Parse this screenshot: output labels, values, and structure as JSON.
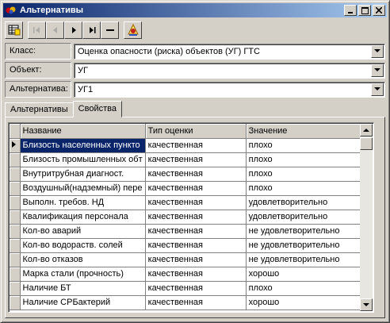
{
  "window": {
    "title": "Альтернативы",
    "icon": "app-icon"
  },
  "toolbar": {
    "buttons": [
      {
        "name": "table-view-icon",
        "enabled": true
      },
      {
        "name": "first-record-icon",
        "enabled": false
      },
      {
        "name": "prior-record-icon",
        "enabled": false
      },
      {
        "name": "next-record-icon",
        "enabled": true
      },
      {
        "name": "last-record-icon",
        "enabled": true
      },
      {
        "name": "delete-record-icon",
        "enabled": true
      },
      {
        "name": "refresh-icon",
        "enabled": true
      }
    ]
  },
  "fields": {
    "class_label": "Класс:",
    "class_value": "Оценка опасности (риска) объектов (УГ) ГТС",
    "object_label": "Объект:",
    "object_value": "УГ",
    "alternative_label": "Альтернатива:",
    "alternative_value": "УГ1"
  },
  "tabs": [
    {
      "label": "Альтернативы",
      "active": false
    },
    {
      "label": "Свойства",
      "active": true
    }
  ],
  "grid": {
    "columns": [
      "Название",
      "Тип оценки",
      "Значение"
    ],
    "rows": [
      {
        "name": "Близость населенных пункто",
        "type": "качественная",
        "value": "плохо"
      },
      {
        "name": "Близость промышленных обт",
        "type": "качественная",
        "value": "плохо"
      },
      {
        "name": "Внутритрубная диагност.",
        "type": "качественная",
        "value": "плохо"
      },
      {
        "name": "Воздушный(надземный) пере",
        "type": "качественная",
        "value": "плохо"
      },
      {
        "name": "Выполн. требов. НД",
        "type": "качественная",
        "value": "удовлетворительно"
      },
      {
        "name": "Квалификация персонала",
        "type": "качественная",
        "value": "удовлетворительно"
      },
      {
        "name": "Кол-во аварий",
        "type": "качественная",
        "value": "не удовлетворительно"
      },
      {
        "name": "Кол-во водораств. солей",
        "type": "качественная",
        "value": "не удовлетворительно"
      },
      {
        "name": "Кол-во отказов",
        "type": "качественная",
        "value": "не удовлетворительно"
      },
      {
        "name": "Марка стали (прочность)",
        "type": "качественная",
        "value": "хорошо"
      },
      {
        "name": "Наличие БТ",
        "type": "качественная",
        "value": "плохо"
      },
      {
        "name": "Наличие СРБактерий",
        "type": "качественная",
        "value": "хорошо"
      }
    ],
    "current_row": 0
  }
}
